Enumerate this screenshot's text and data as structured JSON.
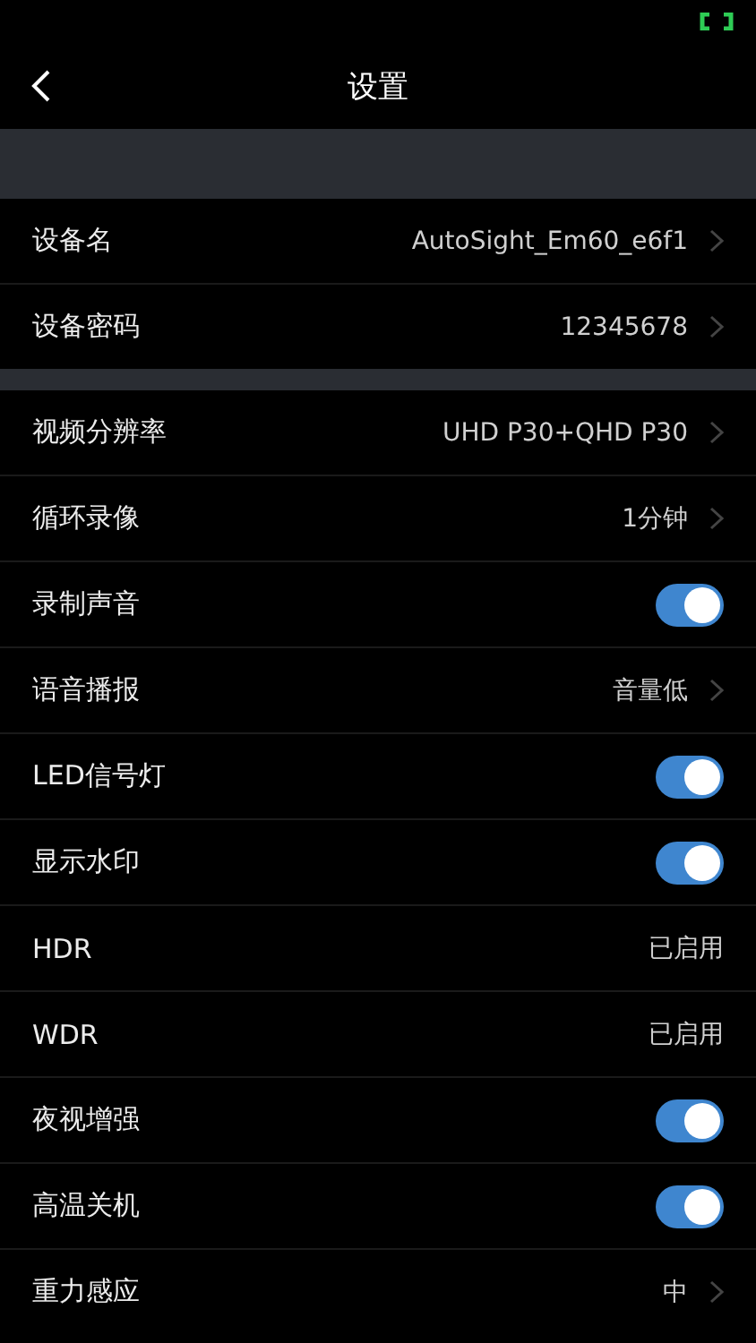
{
  "nav": {
    "title": "设置"
  },
  "groups": [
    {
      "rows": [
        {
          "kind": "link",
          "label": "设备名",
          "value": "AutoSight_Em60_e6f1"
        },
        {
          "kind": "link",
          "label": "设备密码",
          "value": "12345678"
        }
      ]
    },
    {
      "rows": [
        {
          "kind": "link",
          "label": "视频分辨率",
          "value": "UHD P30+QHD P30"
        },
        {
          "kind": "link",
          "label": "循环录像",
          "value": "1分钟"
        },
        {
          "kind": "toggle",
          "label": "录制声音",
          "on": true
        },
        {
          "kind": "link",
          "label": "语音播报",
          "value": "音量低"
        },
        {
          "kind": "toggle",
          "label": "LED信号灯",
          "on": true
        },
        {
          "kind": "toggle",
          "label": "显示水印",
          "on": true
        },
        {
          "kind": "value",
          "label": "HDR",
          "value": "已启用"
        },
        {
          "kind": "value",
          "label": "WDR",
          "value": "已启用"
        },
        {
          "kind": "toggle",
          "label": "夜视增强",
          "on": true
        },
        {
          "kind": "toggle",
          "label": "高温关机",
          "on": true
        },
        {
          "kind": "link",
          "label": "重力感应",
          "value": "中"
        }
      ]
    }
  ]
}
